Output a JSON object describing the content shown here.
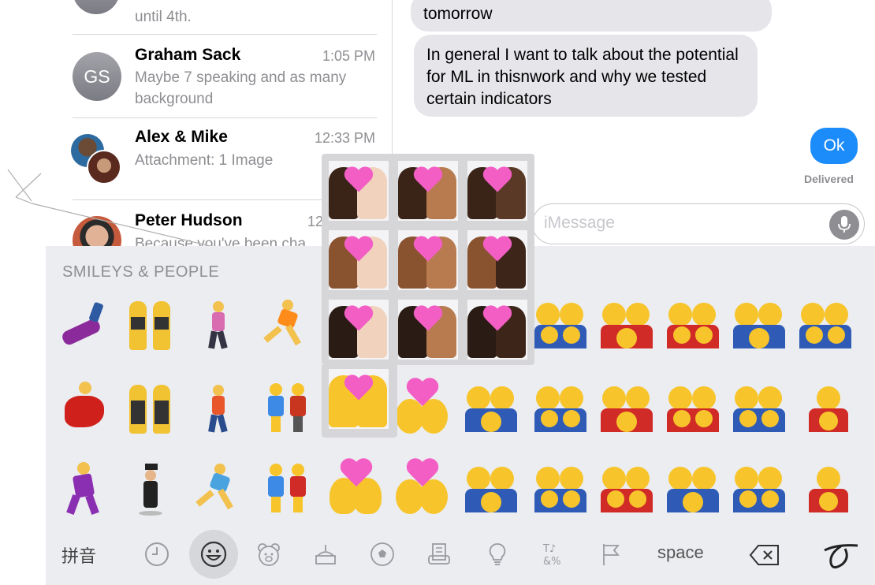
{
  "conversations": [
    {
      "name": "",
      "time": "",
      "preview": "until 4th."
    },
    {
      "name": "Graham Sack",
      "initials": "GS",
      "time": "1:05 PM",
      "preview": "Maybe 7 speaking and as many background"
    },
    {
      "name": "Alex & Mike",
      "time": "12:33 PM",
      "preview": "Attachment: 1 Image"
    },
    {
      "name": "Peter Hudson",
      "time": "12",
      "preview": "Because you've been cha"
    }
  ],
  "transcript": {
    "incoming_1": "tomorrow",
    "incoming_2": "In general I want to talk about the potential for ML in thisnwork and why we tested certain indicators",
    "outgoing_1": "Ok",
    "status": "Delivered"
  },
  "input": {
    "placeholder": "iMessage"
  },
  "keyboard": {
    "category_title": "SMILEYS & PEOPLE",
    "pinyin_label": "拼音",
    "space_label": "space",
    "icons": [
      "clock-icon",
      "smiley-icon",
      "bear-icon",
      "food-icon",
      "ball-icon",
      "building-icon",
      "lightbulb-icon",
      "symbols-icon",
      "flag-icon",
      "delete-icon",
      "handwriting-icon"
    ],
    "selected_category": "smiley-icon"
  },
  "skin_tone_popover": {
    "variants": 10,
    "description_icon": "couple-with-heart-icon"
  },
  "colors": {
    "ios_blue": "#1c8cfb",
    "bubble_gray": "#e5e5ea",
    "keyboard_bg": "#ebedf0",
    "heart_pink": "#f35ec5",
    "emoji_yellow": "#f7c52b"
  }
}
